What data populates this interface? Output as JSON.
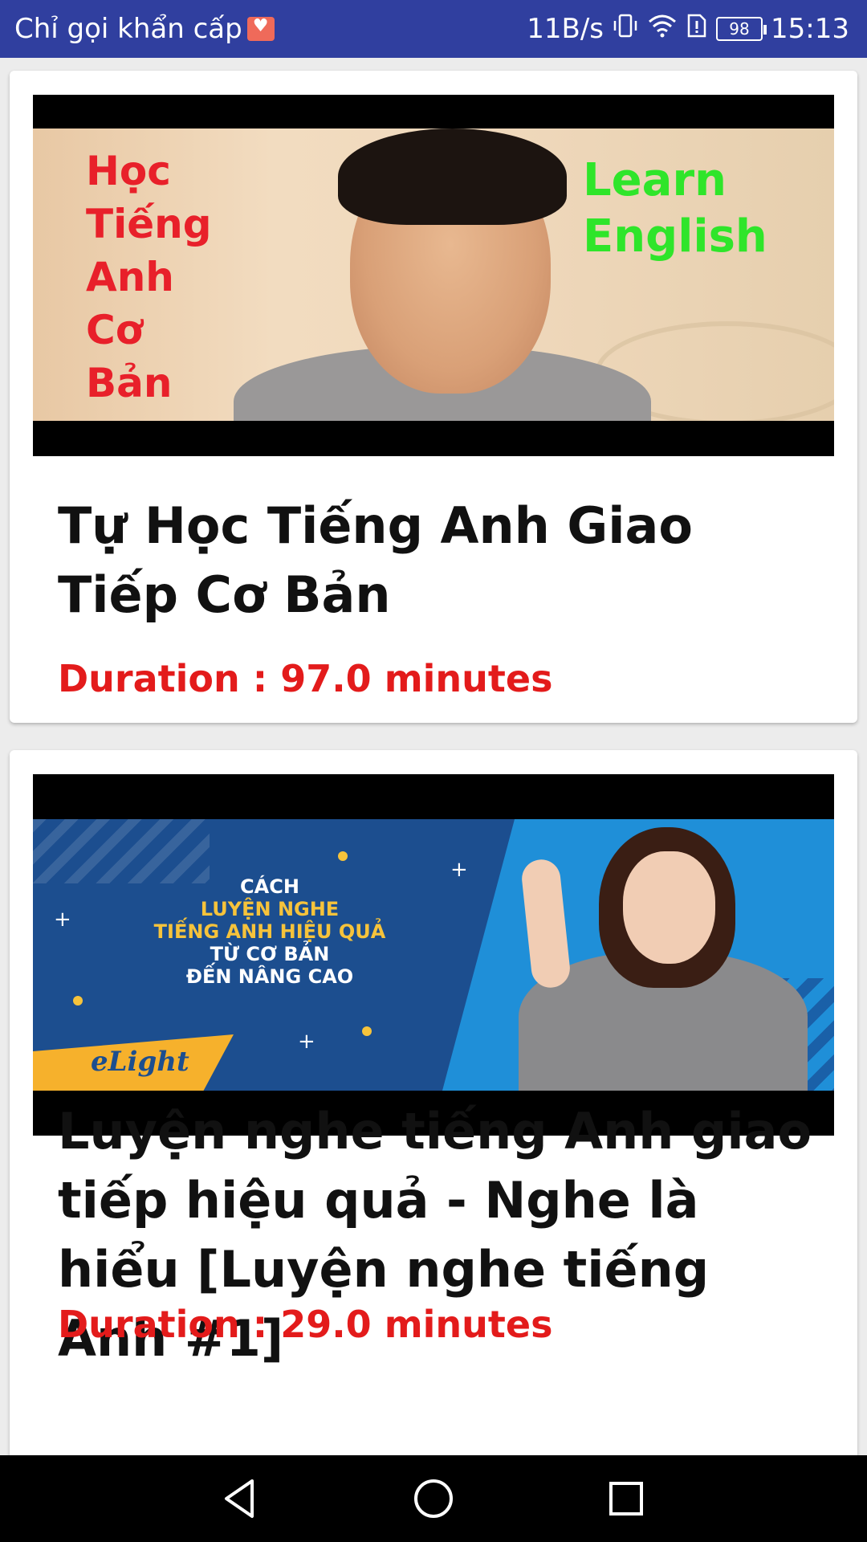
{
  "status_bar": {
    "carrier": "Chỉ gọi khẩn cấp",
    "network_speed": "11B/s",
    "battery": "98",
    "time": "15:13"
  },
  "feed": {
    "items": [
      {
        "thumbnail": {
          "text_left": [
            "Học",
            "Tiếng",
            "Anh",
            "Cơ",
            "Bản"
          ],
          "text_right": [
            "Learn",
            "English"
          ]
        },
        "title": "Tự Học Tiếng Anh Giao Tiếp Cơ Bản",
        "duration": "Duration : 97.0 minutes"
      },
      {
        "thumbnail": {
          "lines": [
            "CÁCH",
            "LUYỆN NGHE",
            "TIẾNG ANH HIỆU QUẢ",
            "TỪ CƠ BẢN",
            "ĐẾN NÂNG CAO"
          ],
          "logo": "eLight"
        },
        "title": "Luyện nghe tiếng Anh giao tiếp hiệu quả - Nghe là hiểu [Luyện nghe tiếng Anh #1]",
        "duration": "Duration : 29.0 minutes"
      }
    ]
  },
  "colors": {
    "status_bar": "#303f9f",
    "duration_text": "#e31b1b",
    "title_text": "#111111"
  },
  "nav_bar": {
    "icons": [
      "back-icon",
      "home-icon",
      "recents-icon"
    ]
  }
}
